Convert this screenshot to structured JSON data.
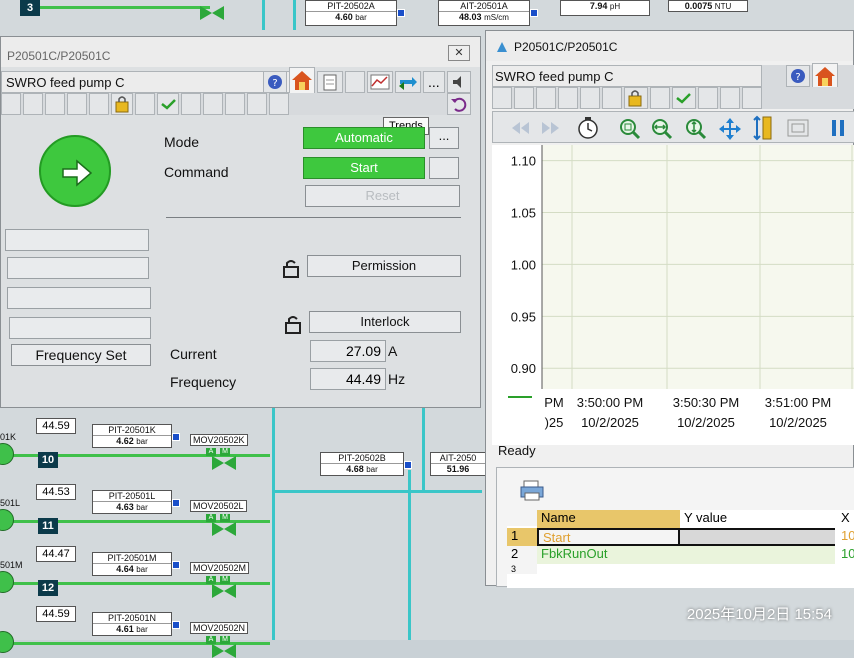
{
  "scada_top": {
    "badge_top": "3",
    "tags": [
      {
        "name": "PIT-20502A",
        "value": "4.60",
        "unit": "bar"
      },
      {
        "name": "AIT-20501A",
        "value": "48.03",
        "unit": "mS/cm"
      },
      {
        "value": "7.94",
        "unit": "pH"
      },
      {
        "value": "0.0075",
        "unit": "NTU"
      }
    ]
  },
  "scada_rows": [
    {
      "left_label": "01K",
      "badge": "10",
      "val": "44.59",
      "pit": "PIT-20501K",
      "pit_val": "4.62",
      "unit": "bar",
      "mov": "MOV20502K"
    },
    {
      "left_label": "501L",
      "badge": "11",
      "val": "44.53",
      "pit": "PIT-20501L",
      "pit_val": "4.63",
      "unit": "bar",
      "mov": "MOV20502L"
    },
    {
      "left_label": "501M",
      "badge": "12",
      "val": "44.47",
      "pit": "PIT-20501M",
      "pit_val": "4.64",
      "unit": "bar",
      "mov": "MOV20502M"
    },
    {
      "left_label": "",
      "badge": "",
      "val": "44.59",
      "pit": "PIT-20501N",
      "pit_val": "4.61",
      "unit": "bar",
      "mov": "MOV20502N"
    }
  ],
  "scada_mid": {
    "pit_b": {
      "name": "PIT-20502B",
      "value": "4.68",
      "unit": "bar"
    },
    "ait": {
      "name": "AIT-2050",
      "value": "51.96"
    }
  },
  "faceplate": {
    "window_title": "P20501C/P20501C",
    "close": "✕",
    "description": "SWRO feed pump C",
    "tooltip": "Trends",
    "mode_label": "Mode",
    "mode_value": "Automatic",
    "command_label": "Command",
    "command_value": "Start",
    "reset_label": "Reset",
    "more_label": "...",
    "permission_label": "Permission",
    "interlock_label": "Interlock",
    "frequency_set_label": "Frequency Set",
    "current_label": "Current",
    "current_value": "27.09",
    "current_unit": "A",
    "frequency_label": "Frequency",
    "frequency_value": "44.49",
    "frequency_unit": "Hz",
    "toolbar_more": "..."
  },
  "trend": {
    "window_title": "P20501C/P20501C",
    "description": "SWRO feed pump C",
    "status": "Ready",
    "y_ticks": [
      "1.10",
      "1.05",
      "1.00",
      "0.95",
      "0.90"
    ],
    "x_ticks": [
      {
        "time": "PM",
        "date": ")25"
      },
      {
        "time": "3:50:00 PM",
        "date": "10/2/2025"
      },
      {
        "time": "3:50:30 PM",
        "date": "10/2/2025"
      },
      {
        "time": "3:51:00 PM",
        "date": "10/2/2025"
      }
    ],
    "table_headers": [
      "Name",
      "Y value",
      "X"
    ],
    "table_rows": [
      {
        "idx": "1",
        "name": "Start",
        "x": "10"
      },
      {
        "idx": "2",
        "name": "FbkRunOut",
        "x": "10"
      },
      {
        "idx": "3",
        "name": "",
        "x": ""
      }
    ],
    "colors": {
      "start": "#e0a030",
      "fbk": "#2aa02a",
      "header": "#e8c66a"
    }
  },
  "timestamp": "2025年10月2日 15:54"
}
